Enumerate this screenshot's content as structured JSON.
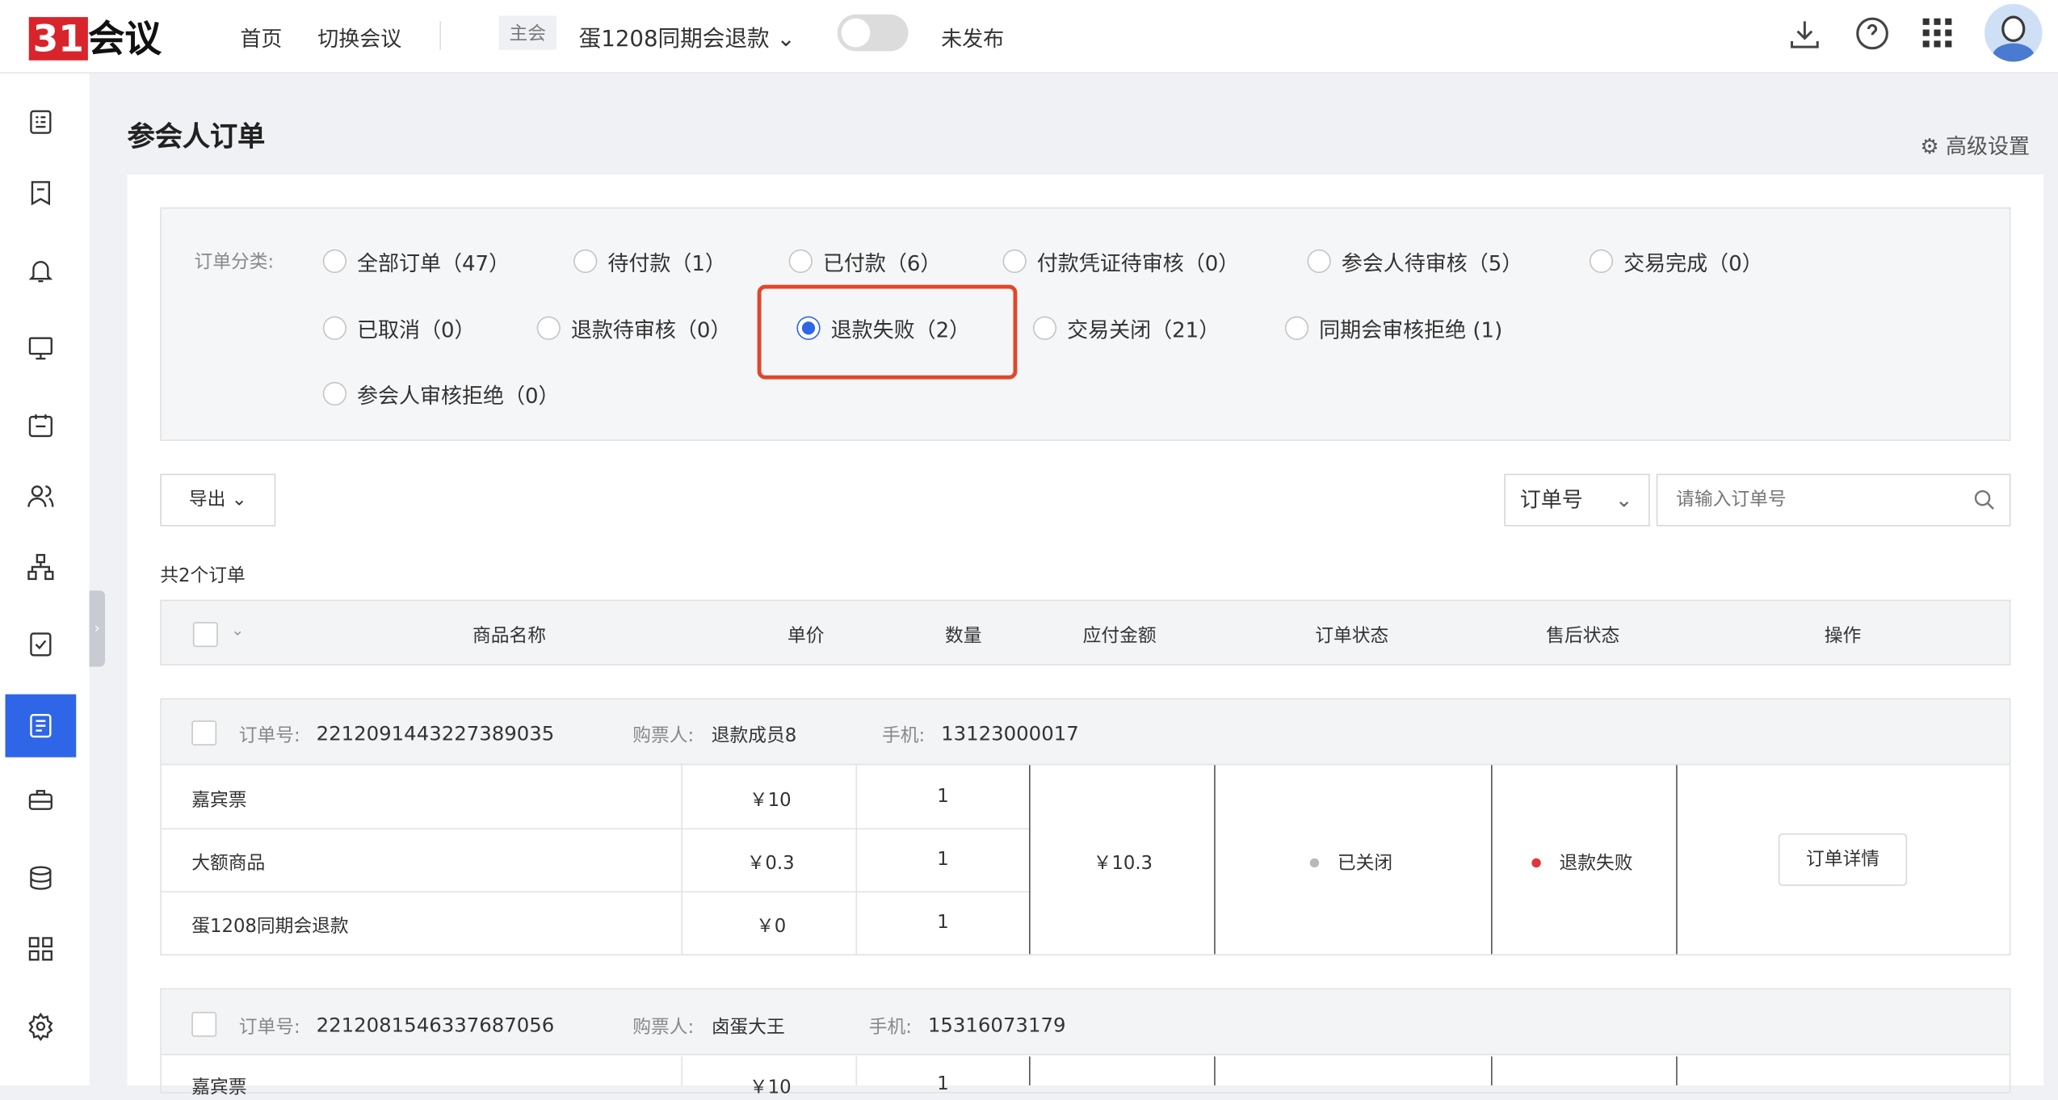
{
  "header": {
    "logo": "31会议",
    "nav": [
      "首页",
      "切换会议"
    ],
    "main_tag": "主会",
    "meeting": "蛋1208同期会退款",
    "publish_status": "未发布"
  },
  "page": {
    "title": "参会人订单",
    "advanced": "高级设置"
  },
  "filter": {
    "label": "订单分类:",
    "options": [
      "全部订单（47）",
      "待付款（1）",
      "已付款（6）",
      "付款凭证待审核（0）",
      "参会人待审核（5）",
      "交易完成（0）",
      "已取消（0）",
      "退款待审核（0）",
      "退款失败（2）",
      "交易关闭（21）",
      "同期会审核拒绝 (1)",
      "参会人审核拒绝（0）"
    ]
  },
  "toolbar": {
    "export": "导出",
    "search_type": "订单号",
    "search_placeholder": "请输入订单号",
    "total": "共2个订单"
  },
  "table": {
    "headers": [
      "商品名称",
      "单价",
      "数量",
      "应付金额",
      "订单状态",
      "售后状态",
      "操作"
    ]
  },
  "orders": [
    {
      "no_label": "订单号:",
      "no": "2212091443227389035",
      "buyer_label": "购票人:",
      "buyer": "退款成员8",
      "phone_label": "手机:",
      "phone": "13123000017",
      "items": [
        {
          "name": "嘉宾票",
          "price": "￥10",
          "qty": "1"
        },
        {
          "name": "大额商品",
          "price": "￥0.3",
          "qty": "1"
        },
        {
          "name": "蛋1208同期会退款",
          "price": "￥0",
          "qty": "1"
        }
      ],
      "total": "￥10.3",
      "status": "已关闭",
      "after": "退款失败",
      "action": "订单详情"
    },
    {
      "no_label": "订单号:",
      "no": "2212081546337687056",
      "buyer_label": "购票人:",
      "buyer": "卤蛋大王",
      "phone_label": "手机:",
      "phone": "15316073179",
      "items": [
        {
          "name": "嘉宾票",
          "price": "￥10",
          "qty": "1"
        }
      ]
    }
  ]
}
